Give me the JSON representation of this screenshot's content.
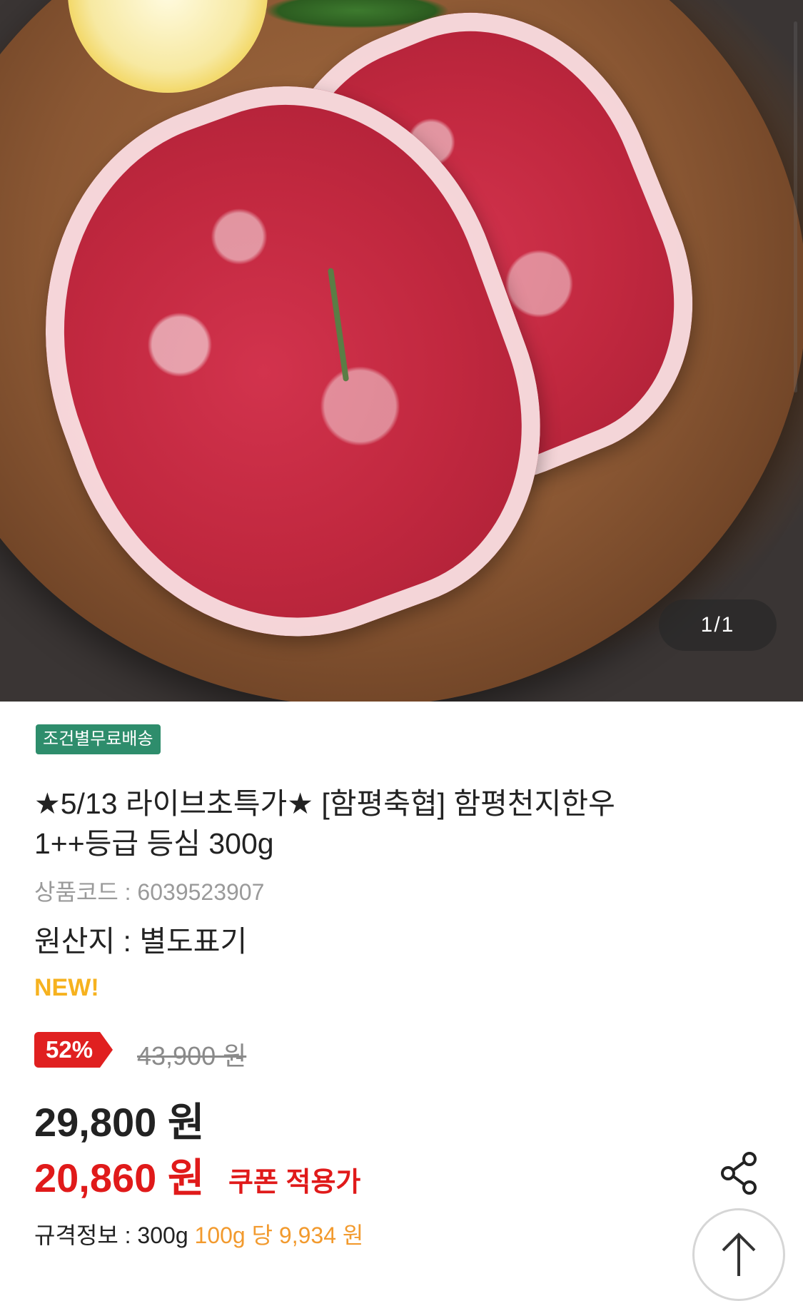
{
  "gallery": {
    "pager": "1/1"
  },
  "product": {
    "shipping_badge": "조건별무료배송",
    "title_line1": "★5/13 라이브초특가★ [함평축협] 함평천지한우",
    "title_line2": "1++등급 등심 300g",
    "code": "상품코드 : 6039523907",
    "origin": "원산지 : 별도표기",
    "new_tag": "NEW!"
  },
  "pricing": {
    "discount_pct": "52%",
    "original_price": "43,900 원",
    "price": "29,800 원",
    "coupon_price": "20,860 원",
    "coupon_label": "쿠폰 적용가"
  },
  "spec": {
    "label": "규격정보 : 300g",
    "per_unit": "100g 당  9,934 원"
  },
  "icons": {
    "share": "share-icon",
    "scroll_top": "arrow-up-icon"
  },
  "colors": {
    "discount": "#e02020",
    "coupon": "#e01a1a",
    "new": "#f6b21f",
    "shipping": "#2e8d6c",
    "per_unit": "#f29a2e"
  }
}
